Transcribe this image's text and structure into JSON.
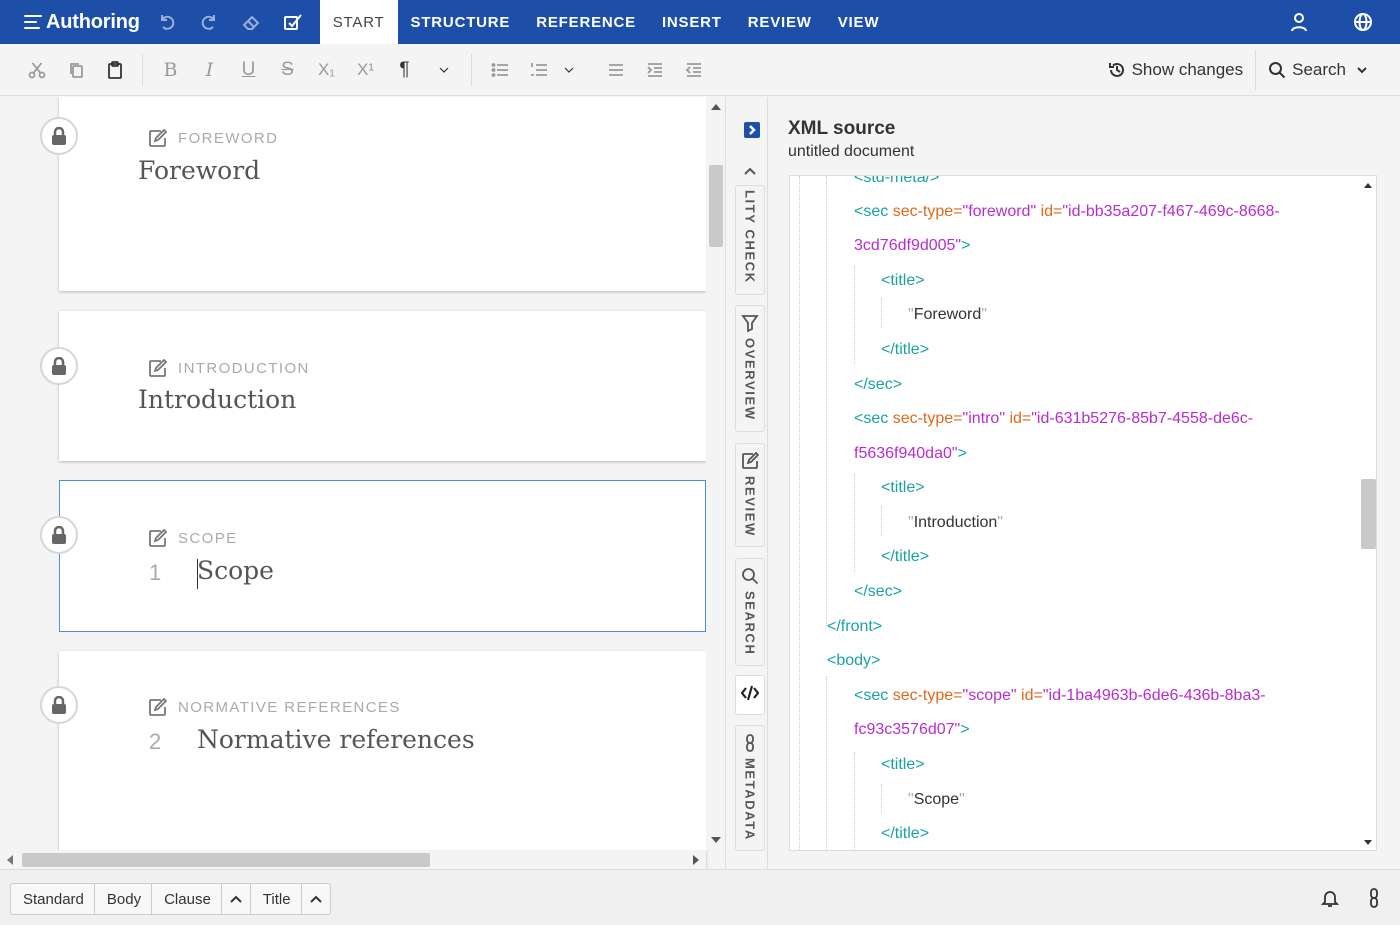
{
  "app": {
    "title": "Authoring"
  },
  "menu": {
    "tabs": [
      {
        "label": "START"
      },
      {
        "label": "STRUCTURE"
      },
      {
        "label": "REFERENCE"
      },
      {
        "label": "INSERT"
      },
      {
        "label": "REVIEW"
      },
      {
        "label": "VIEW"
      }
    ]
  },
  "toolbar": {
    "show_changes": "Show changes",
    "search": "Search",
    "subscript": "X₁",
    "superscript": "X¹",
    "pilcrow": "¶"
  },
  "editor": {
    "sections": [
      {
        "label": "FOREWORD",
        "title": "Foreword",
        "number": ""
      },
      {
        "label": "INTRODUCTION",
        "title": "Introduction",
        "number": ""
      },
      {
        "label": "SCOPE",
        "title": "Scope",
        "number": "1"
      },
      {
        "label": "NORMATIVE REFERENCES",
        "title": "Normative references",
        "number": "2"
      }
    ]
  },
  "side_tabs": [
    {
      "label": "LITY CHECK"
    },
    {
      "label": "OVERVIEW"
    },
    {
      "label": "REVIEW"
    },
    {
      "label": "SEARCH"
    },
    {
      "label": "METADATA"
    }
  ],
  "xml_panel": {
    "title": "XML source",
    "subtitle": "untitled document",
    "lines": {
      "l0": "<std-meta/>",
      "l1_tag": "<sec",
      "l1_attr1": "sec-type=",
      "l1_val1": "\"foreword\"",
      "l1_attr2": "id=",
      "l1_val2a": "\"id-bb35a207-f467-469c-8668-",
      "l1_val2b": "3cd76df9d005\"",
      "l1_close": ">",
      "title_open": "<title>",
      "t1": "Foreword",
      "title_close": "</title>",
      "sec_close": "</sec>",
      "l2_val1": "\"intro\"",
      "l2_val2a": "\"id-631b5276-85b7-4558-de6c-",
      "l2_val2b": "f5636f940da0\"",
      "t2": "Introduction",
      "front_close": "</front>",
      "body_open": "<body>",
      "l3_val1": "\"scope\"",
      "l3_val2a": "\"id-1ba4963b-6de6-436b-8ba3-",
      "l3_val2b": "fc93c3576d07\"",
      "t3": "Scope",
      "quote": "\""
    }
  },
  "statusbar": {
    "breadcrumbs": [
      "Standard",
      "Body",
      "Clause",
      "Title"
    ]
  }
}
